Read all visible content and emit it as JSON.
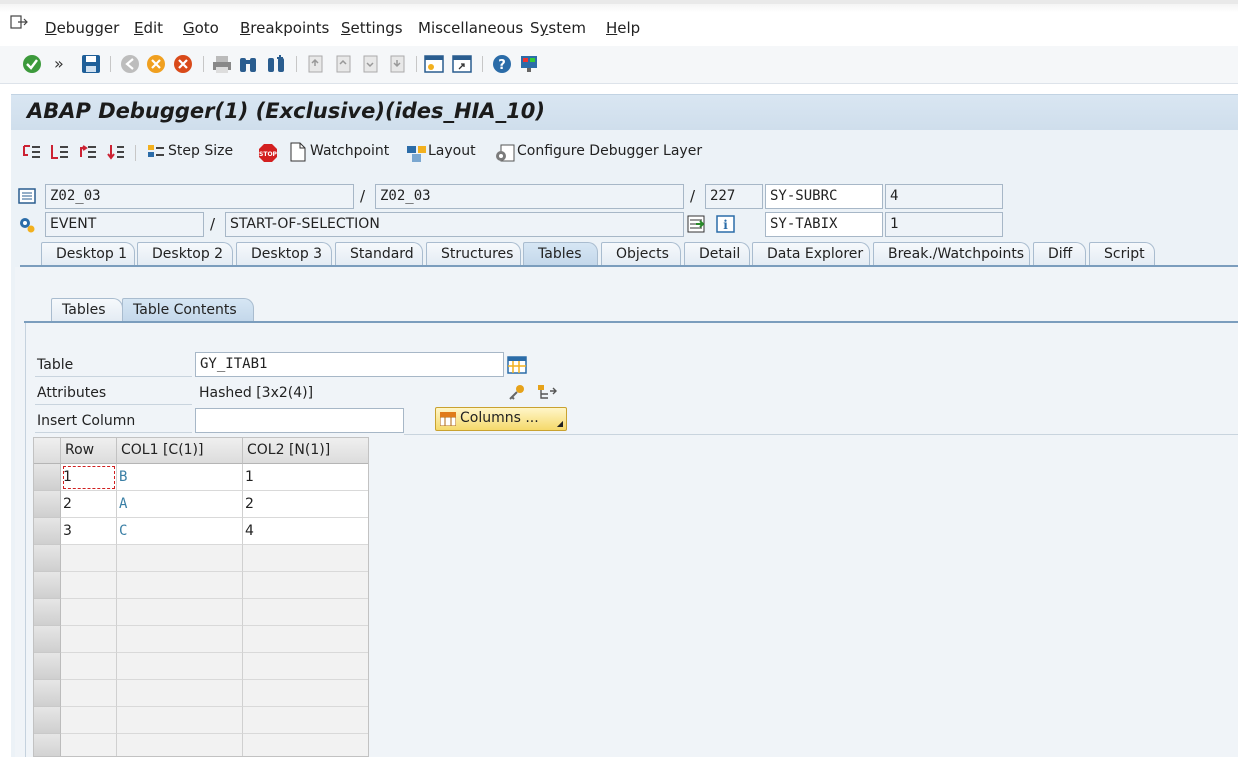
{
  "menubar": {
    "items": [
      {
        "label": "Debugger",
        "u": "D"
      },
      {
        "label": "Edit",
        "u": "E"
      },
      {
        "label": "Goto",
        "u": "G"
      },
      {
        "label": "Breakpoints",
        "u": "B"
      },
      {
        "label": "Settings",
        "u": "S"
      },
      {
        "label": "Miscellaneous",
        "u": ""
      },
      {
        "label": "System",
        "u": "y"
      },
      {
        "label": "Help",
        "u": "H"
      }
    ]
  },
  "toolbar": {
    "icons": [
      "check-icon",
      "more-icon",
      "save-icon",
      "back-icon",
      "exit-icon",
      "cancel-icon",
      "print-icon",
      "find-icon",
      "find-next-icon",
      "first-page-icon",
      "prev-page-icon",
      "next-page-icon",
      "last-page-icon",
      "new-session-icon",
      "shortcut-icon",
      "help-icon",
      "customize-layout-icon"
    ]
  },
  "title": "ABAP Debugger(1)  (Exclusive)(ides_HIA_10)",
  "apptoolbar": {
    "step_size": "Step Size",
    "watchpoint": "Watchpoint",
    "layout": "Layout",
    "configure": "Configure Debugger Layer"
  },
  "header": {
    "program": "Z02_03",
    "include": "Z02_03",
    "line": "227",
    "sy1_name": "SY-SUBRC",
    "sy1_value": "4",
    "event_type": "EVENT",
    "event_name": "START-OF-SELECTION",
    "sy2_name": "SY-TABIX",
    "sy2_value": "1",
    "slash": "/"
  },
  "tabs": [
    {
      "label": "Desktop 1"
    },
    {
      "label": "Desktop 2"
    },
    {
      "label": "Desktop 3"
    },
    {
      "label": "Standard"
    },
    {
      "label": "Structures"
    },
    {
      "label": "Tables"
    },
    {
      "label": "Objects"
    },
    {
      "label": "Detail"
    },
    {
      "label": "Data Explorer"
    },
    {
      "label": "Break./Watchpoints"
    },
    {
      "label": "Diff"
    },
    {
      "label": "Script"
    }
  ],
  "active_tab": "Tables",
  "subtabs": [
    {
      "label": "Tables"
    },
    {
      "label": "Table Contents"
    }
  ],
  "form": {
    "table_label": "Table",
    "table_value": "GY_ITAB1",
    "attributes_label": "Attributes",
    "attributes_value": "Hashed [3x2(4)]",
    "insert_column_label": "Insert Column",
    "insert_column_value": "",
    "columns_button": "Columns ..."
  },
  "grid": {
    "headers": [
      "Row",
      "COL1 [C(1)]",
      "COL2 [N(1)]"
    ],
    "rows": [
      [
        "1",
        "B",
        "1"
      ],
      [
        "2",
        "A",
        "2"
      ],
      [
        "3",
        "C",
        "4"
      ]
    ]
  }
}
